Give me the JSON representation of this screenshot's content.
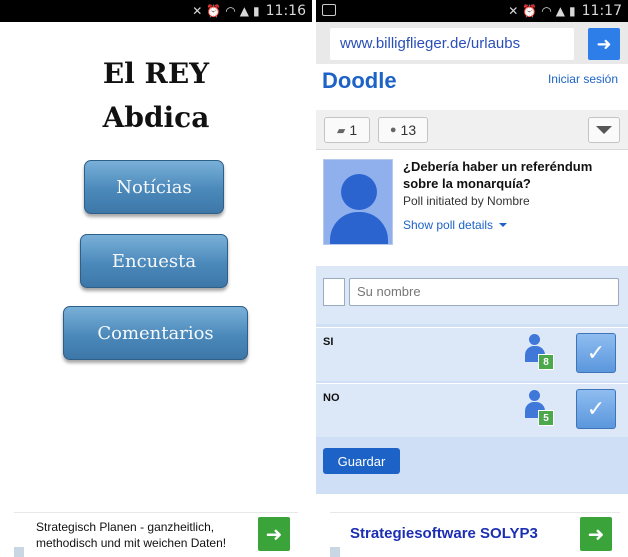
{
  "left": {
    "status_time": "11:16",
    "title_line1": "El REY",
    "title_line2": "Abdica",
    "buttons": {
      "noticias": "Notícias",
      "encuesta": "Encuesta",
      "comentarios": "Comentarios"
    },
    "ad": {
      "text": "Strategisch Planen - ganzheitlich, methodisch und mit weichen Daten!"
    }
  },
  "right": {
    "status_time": "11:17",
    "url": "www.billigflieger.de/urlaubs",
    "logo": "Doodle",
    "login": "Iniciar sesión",
    "toolbar": {
      "comments_count": "1",
      "participants_count": "13"
    },
    "poll": {
      "question": "¿Debería haber un referéndum sobre la monarquía?",
      "initiated_by": "Poll initiated by Nombre",
      "details_link": "Show poll details"
    },
    "form": {
      "name_placeholder": "Su nombre",
      "options": [
        {
          "label": "SI",
          "count": "8"
        },
        {
          "label": "NO",
          "count": "5"
        }
      ],
      "save_label": "Guardar"
    },
    "ad": {
      "text": "Strategiesoftware SOLYP3"
    }
  },
  "colors": {
    "menu_button": "#4b89bb",
    "doodle_blue": "#1d63c7",
    "vote_area": "#dce8f8",
    "badge_green": "#4ca84c",
    "ad_green": "#3aa33a"
  },
  "icons": {
    "status": [
      "mute-icon",
      "alarm-icon",
      "wifi-icon",
      "signal-icon",
      "battery-icon"
    ],
    "comments": "comment-icon",
    "participants": "person-icon",
    "menu": "dropdown-triangle-icon",
    "vote": "checkmark-icon",
    "ad_go": "arrow-right-icon"
  }
}
